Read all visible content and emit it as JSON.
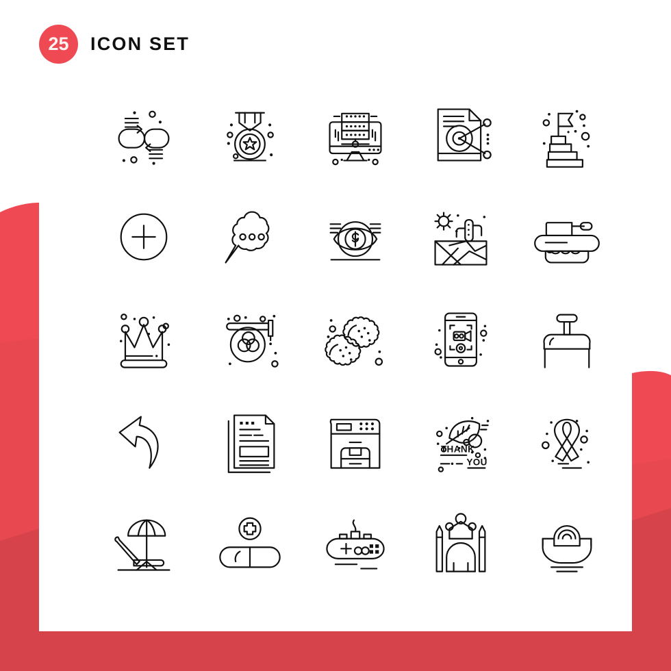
{
  "header": {
    "count": "25",
    "title": "ICON SET"
  },
  "theme": {
    "accent": "#ef4a54",
    "accent_dark": "#d6434a",
    "accent_mid": "#e8484f",
    "card_bg": "#ffffff",
    "icon_stroke": "#111111"
  },
  "grid": {
    "columns": 5,
    "rows": 5,
    "total": 25
  },
  "icons": [
    {
      "name": "data-transfer-sync-icon",
      "label": "Data Transfer"
    },
    {
      "name": "medal-award-icon",
      "label": "Medal"
    },
    {
      "name": "server-monitor-icon",
      "label": "Server Monitor"
    },
    {
      "name": "document-network-share-icon",
      "label": "Document Network"
    },
    {
      "name": "stairs-flag-goal-icon",
      "label": "Goal Stairs"
    },
    {
      "name": "plus-circle-add-icon",
      "label": "Add"
    },
    {
      "name": "thought-bubble-dots-icon",
      "label": "Thought Bubble"
    },
    {
      "name": "eye-dollar-vision-icon",
      "label": "Money Vision"
    },
    {
      "name": "desert-cactus-landscape-icon",
      "label": "Desert"
    },
    {
      "name": "military-tank-icon",
      "label": "Tank"
    },
    {
      "name": "crown-icon",
      "label": "Crown"
    },
    {
      "name": "paint-roller-color-wheel-icon",
      "label": "Color Roller"
    },
    {
      "name": "cookies-icon",
      "label": "Cookies"
    },
    {
      "name": "smartphone-video-camera-icon",
      "label": "Mobile Video"
    },
    {
      "name": "detonator-plunger-icon",
      "label": "Detonator"
    },
    {
      "name": "reply-arrow-icon",
      "label": "Reply"
    },
    {
      "name": "news-document-icon",
      "label": "News Article"
    },
    {
      "name": "printer-icon",
      "label": "Printer"
    },
    {
      "name": "thank-you-leaf-icon",
      "label": "Thank You"
    },
    {
      "name": "awareness-ribbon-icon",
      "label": "Ribbon"
    },
    {
      "name": "beach-chair-umbrella-icon",
      "label": "Beach Chair"
    },
    {
      "name": "pill-medicine-cross-icon",
      "label": "Medicine"
    },
    {
      "name": "game-controller-icon",
      "label": "Game Controller"
    },
    {
      "name": "king-crown-candles-icon",
      "label": "King"
    },
    {
      "name": "bowl-steam-icon",
      "label": "Hot Bowl"
    }
  ],
  "thank_you_icon": {
    "line1": "THANK",
    "line2": "YOU"
  }
}
